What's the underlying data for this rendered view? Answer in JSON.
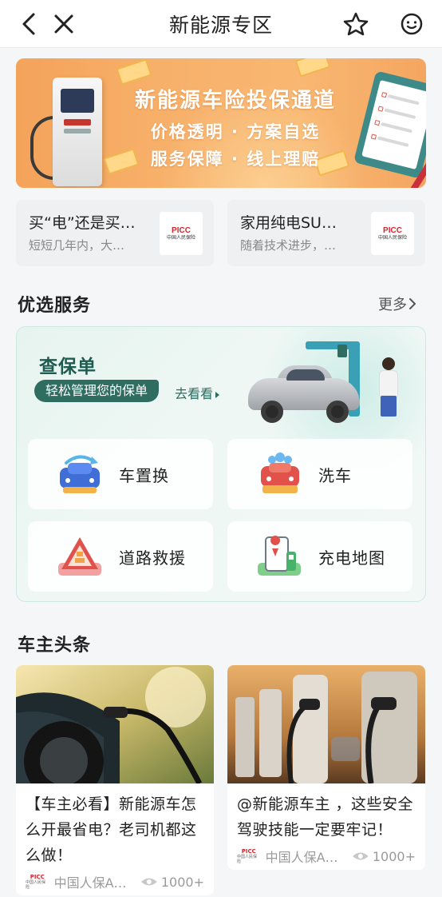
{
  "header": {
    "title": "新能源专区"
  },
  "banner": {
    "title": "新能源车险投保通道",
    "line1": "价格透明 · 方案自选",
    "line2": "服务保障 · 线上理赔"
  },
  "articles": [
    {
      "title": "买“电”还是买…",
      "subtitle": "短短几年内，大…",
      "logo_top": "PICC",
      "logo_bottom": "中国人民保险"
    },
    {
      "title": "家用纯电SU…",
      "subtitle": "随着技术进步，…",
      "logo_top": "PICC",
      "logo_bottom": "中国人民保险"
    }
  ],
  "services": {
    "title": "优选服务",
    "more": "更多",
    "check_policy": {
      "title": "查保单",
      "tag": "轻松管理您的保单",
      "link": "去看看"
    },
    "items": [
      {
        "label": "车置换",
        "icon": "car-swap-icon"
      },
      {
        "label": "洗车",
        "icon": "car-wash-icon"
      },
      {
        "label": "道路救援",
        "icon": "road-rescue-icon"
      },
      {
        "label": "充电地图",
        "icon": "charging-map-icon"
      }
    ]
  },
  "news": {
    "title": "车主头条",
    "items": [
      {
        "text": "【车主必看】新能源车怎么开最省电？老司机都这么做！",
        "source": "中国人保A…",
        "views": "1000+",
        "logo_top": "PICC",
        "logo_bottom": "中国人民保险"
      },
      {
        "text": "@新能源车主 ，这些安全驾驶技能一定要牢记！",
        "source": "中国人保A…",
        "views": "1000+",
        "logo_top": "PICC",
        "logo_bottom": "中国人民保险"
      }
    ]
  },
  "colors": {
    "accent": "#2f6d61",
    "brand_red": "#d5252c",
    "banner_orange": "#f7b06a"
  }
}
